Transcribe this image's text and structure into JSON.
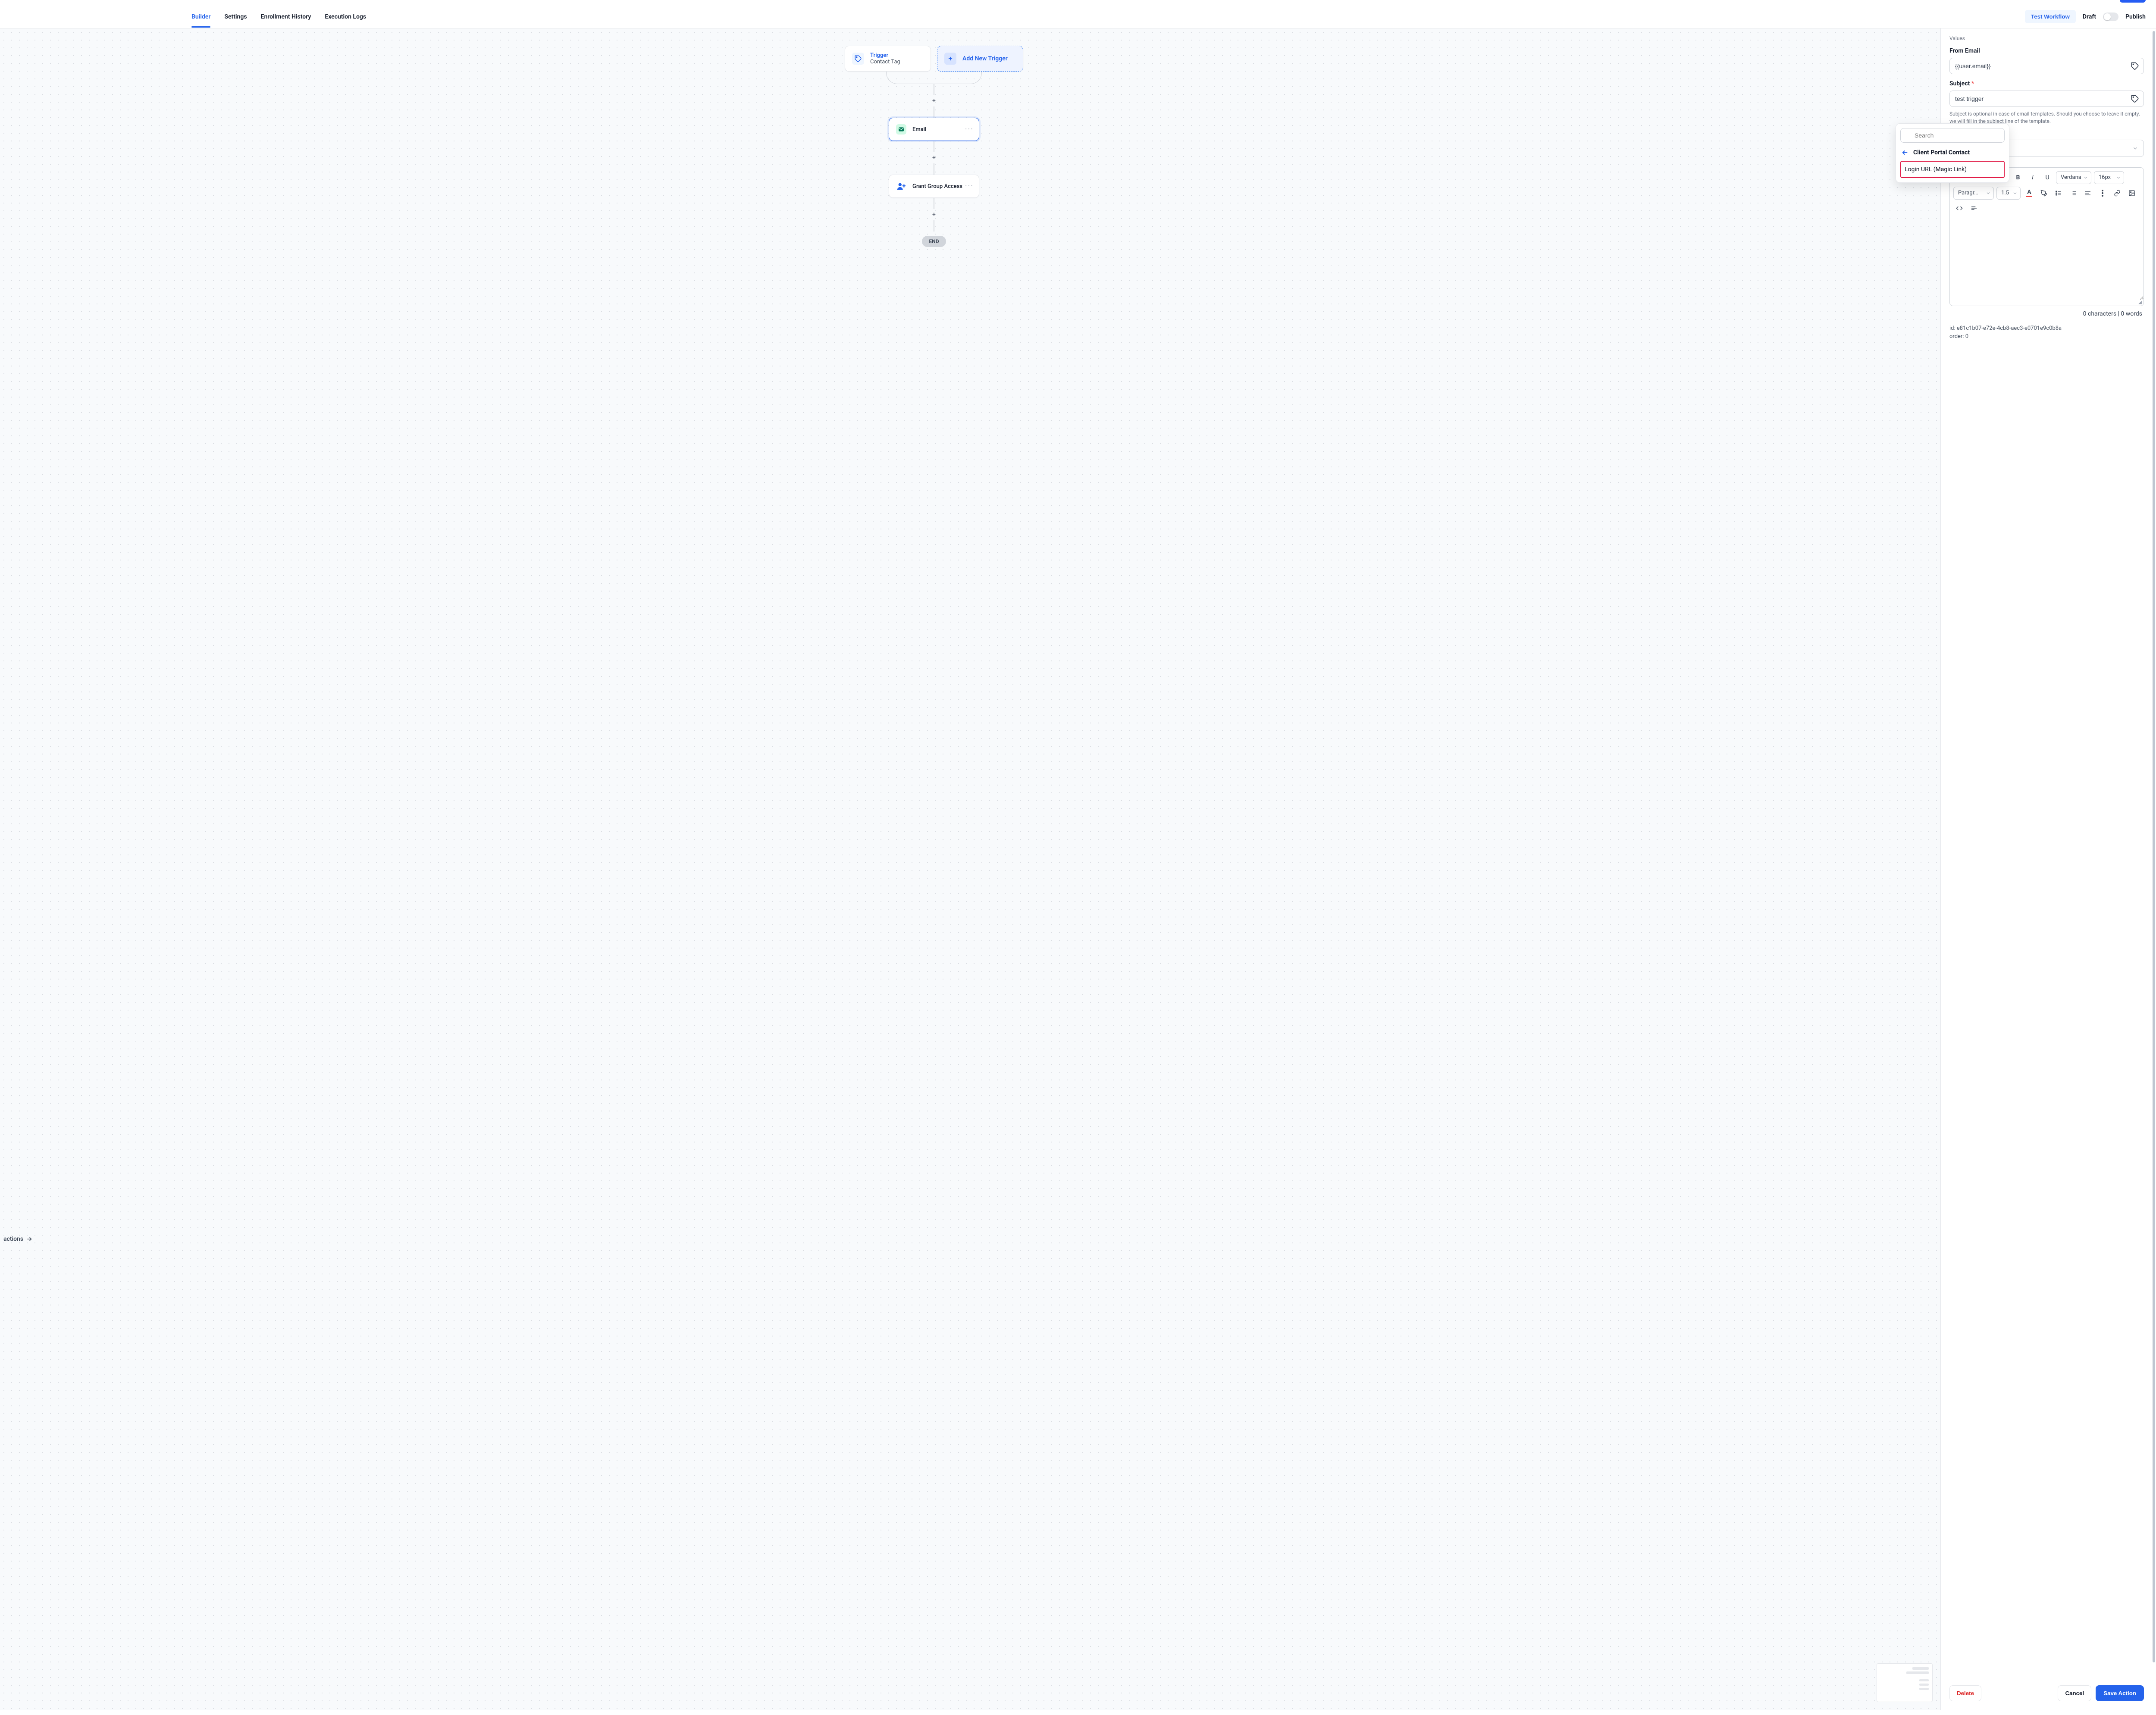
{
  "header": {
    "tabs": {
      "builder": "Builder",
      "settings": "Settings",
      "enrollment": "Enrollment History",
      "execution": "Execution Logs"
    },
    "test_workflow": "Test Workflow",
    "draft": "Draft",
    "publish": "Publish"
  },
  "canvas": {
    "trigger": {
      "title": "Trigger",
      "subtitle": "Contact Tag"
    },
    "add_trigger": "Add New Trigger",
    "nodes": {
      "email": "Email",
      "grant_group": "Grant Group Access"
    },
    "end": "END",
    "actions_label": "actions"
  },
  "popover": {
    "search_placeholder": "Search",
    "back_title": "Client Portal Contact",
    "item_login_url": "Login URL (Magic Link)"
  },
  "panel": {
    "values_label": "Values",
    "from_email_label": "From Email",
    "from_email_value": "{{user.email}}",
    "subject_label": "Subject",
    "subject_value": "test trigger",
    "subject_hint": "Subject is optional in case of email templates. Should you choose to leave it empty, we will fill in the subject line of the template.",
    "toolbar": {
      "font_family": "Verdana",
      "font_size": "16px",
      "paragraph": "Paragr…",
      "line_height": "1.5"
    },
    "counter": "0 characters | 0 words",
    "meta": {
      "id_label": "id:",
      "id_value": "e81c1b07-e72e-4cb8-aec3-e0701e9c0b8a",
      "order_label": "order:",
      "order_value": "0"
    },
    "buttons": {
      "delete": "Delete",
      "cancel": "Cancel",
      "save": "Save Action"
    }
  }
}
